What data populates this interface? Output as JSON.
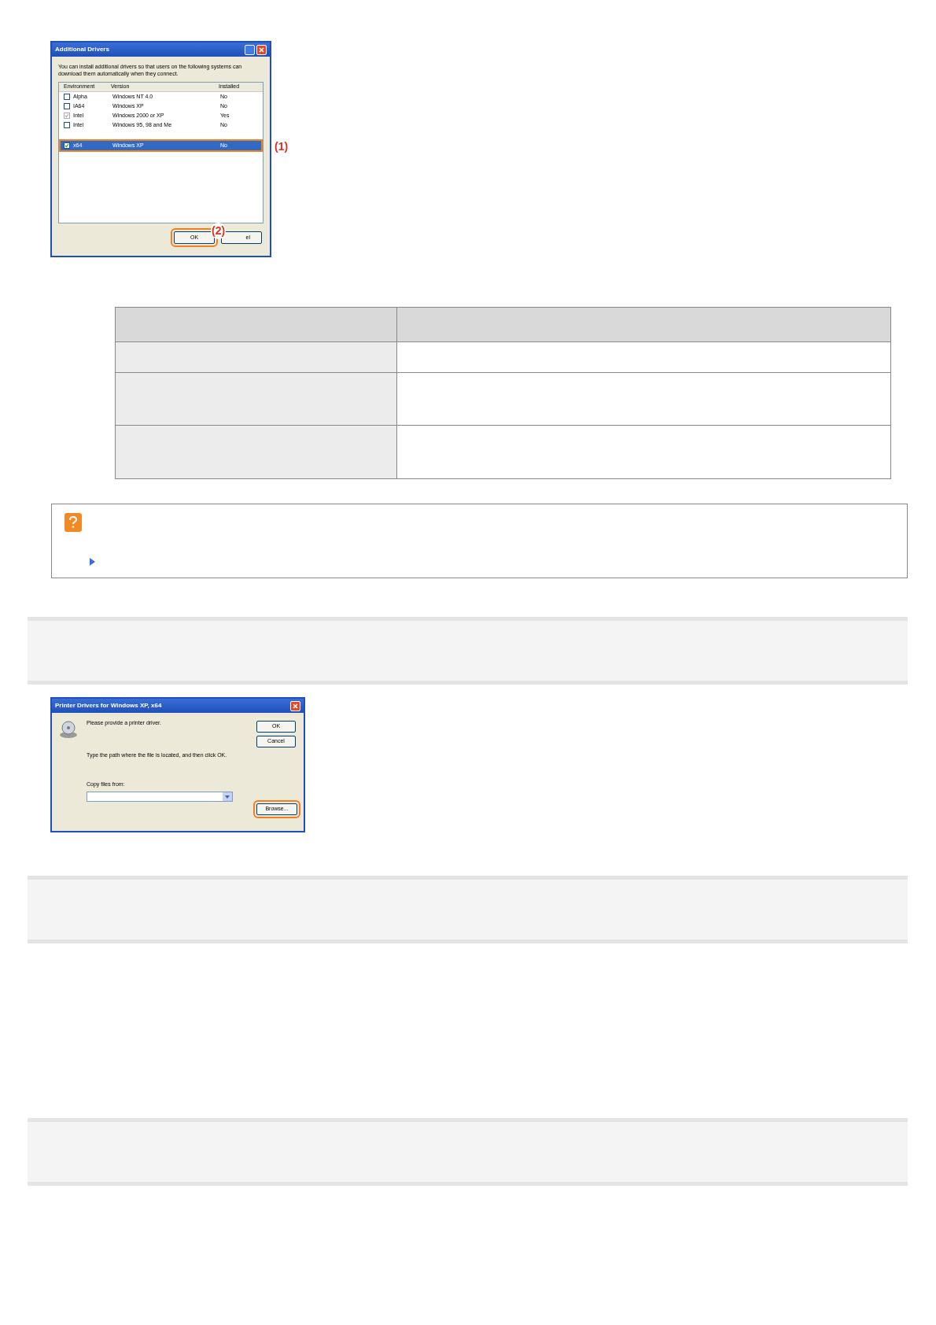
{
  "dialog_1": {
    "title": "Additional Drivers",
    "intro": "You can install additional drivers so that users on the following systems can download them automatically when they connect.",
    "columns": [
      "Environment",
      "Version",
      "Installed"
    ],
    "rows": [
      {
        "environment": "Alpha",
        "version": "Windows NT 4.0",
        "installed": "No",
        "checked": false,
        "disabled": false,
        "selected": false
      },
      {
        "environment": "IA64",
        "version": "Windows XP",
        "installed": "No",
        "checked": false,
        "disabled": false,
        "selected": false
      },
      {
        "environment": "Intel",
        "version": "Windows 2000 or XP",
        "installed": "Yes",
        "checked": true,
        "disabled": true,
        "selected": false
      },
      {
        "environment": "Intel",
        "version": "Windows 95, 98 and Me",
        "installed": "No",
        "checked": false,
        "disabled": false,
        "selected": false
      },
      {
        "environment": "x64",
        "version": "Windows XP",
        "installed": "No",
        "checked": true,
        "disabled": false,
        "selected": true
      }
    ],
    "ok_button": "OK",
    "cancel_button": "el",
    "callouts": [
      "(1)",
      "(2)"
    ]
  },
  "dialog_2": {
    "title": "Printer Drivers for Windows XP, x64",
    "message": "Please provide a printer driver.",
    "instruction": "Type the path where the file is located, and then click OK.",
    "copy_label": "Copy files from:",
    "buttons": [
      "OK",
      "Cancel"
    ],
    "browse_button": "Browse..."
  }
}
